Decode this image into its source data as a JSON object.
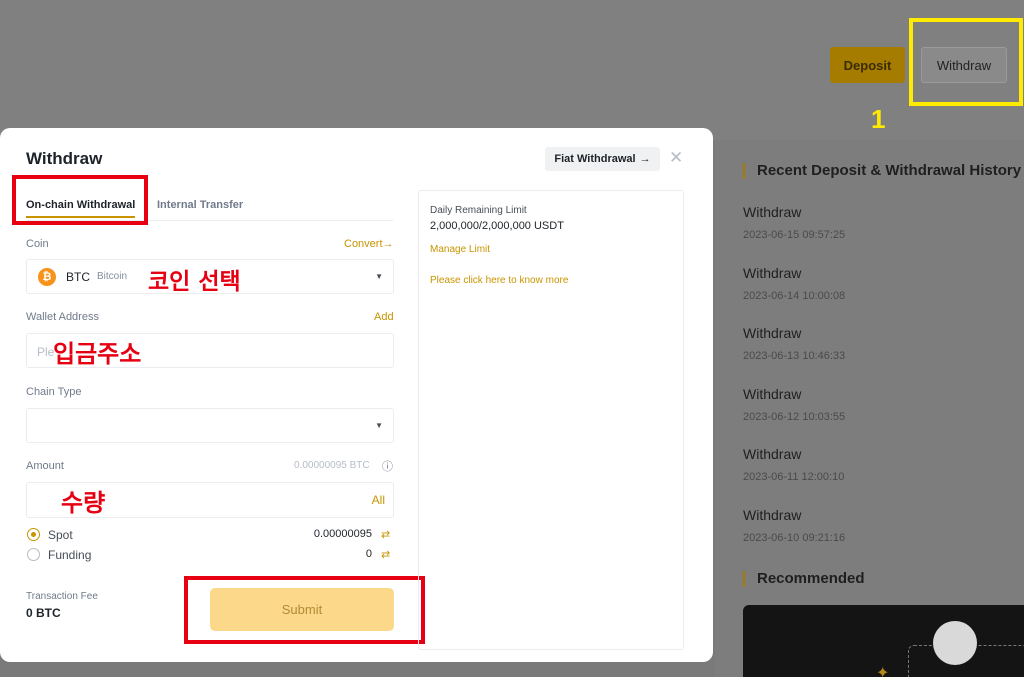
{
  "page": {
    "deposit_label": "Deposit",
    "withdraw_label": "Withdraw",
    "annotation_number": "1"
  },
  "history": {
    "title": "Recent Deposit & Withdrawal History",
    "items": [
      {
        "label": "Withdraw",
        "time": "2023-06-15 09:57:25"
      },
      {
        "label": "Withdraw",
        "time": "2023-06-14 10:00:08"
      },
      {
        "label": "Withdraw",
        "time": "2023-06-13 10:46:33"
      },
      {
        "label": "Withdraw",
        "time": "2023-06-12 10:03:55"
      },
      {
        "label": "Withdraw",
        "time": "2023-06-11 12:00:10"
      },
      {
        "label": "Withdraw",
        "time": "2023-06-10 09:21:16"
      }
    ],
    "recommended_title": "Recommended"
  },
  "modal": {
    "title": "Withdraw",
    "fiat_label": "Fiat Withdrawal",
    "tabs": [
      "On-chain Withdrawal",
      "Internal Transfer"
    ],
    "coin": {
      "label": "Coin",
      "convert_label": "Convert",
      "symbol": "BTC",
      "name": "Bitcoin",
      "annotation": "코인 선택"
    },
    "wallet": {
      "label": "Wallet Address",
      "add_label": "Add",
      "placeholder": "Ple",
      "annotation": "입금주소"
    },
    "chain": {
      "label": "Chain Type"
    },
    "amount": {
      "label": "Amount",
      "available": "0.00000095 BTC",
      "all_label": "All",
      "annotation": "수량"
    },
    "accounts": [
      {
        "label": "Spot",
        "balance": "0.00000095",
        "selected": true
      },
      {
        "label": "Funding",
        "balance": "0",
        "selected": false
      }
    ],
    "fee": {
      "label": "Transaction Fee",
      "value": "0 BTC"
    },
    "submit_label": "Submit",
    "info": {
      "limit_label": "Daily Remaining Limit",
      "limit_value": "2,000,000/2,000,000 USDT",
      "manage_label": "Manage Limit",
      "more_label": "Please click here to know more"
    }
  },
  "colors": {
    "accent": "#c99400",
    "annotation_red": "#e60012",
    "annotation_yellow": "#ffeb00"
  }
}
